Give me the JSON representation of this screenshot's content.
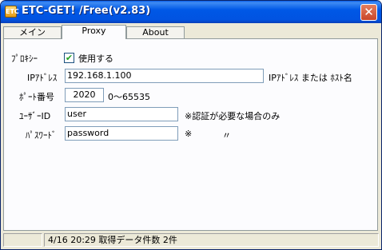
{
  "window": {
    "title": "ETC-GET! /Free(v2.83)",
    "icon_text": "ETC"
  },
  "tabs": [
    {
      "label": "メイン"
    },
    {
      "label": "Proxy"
    },
    {
      "label": "About"
    }
  ],
  "proxy": {
    "use_label": "ﾌﾟﾛｷｼｰ",
    "checkbox_label": "使用する",
    "checkbox_checked": "✔",
    "ip_label": "IPｱﾄﾞﾚｽ",
    "ip_value": "192.168.1.100",
    "ip_hint": "IPｱﾄﾞﾚｽ または ﾎｽﾄ名",
    "port_label": "ﾎﾟｰﾄ番号",
    "port_value": "2020",
    "port_hint": "0～65535",
    "user_label": "ﾕｰｻﾞｰID",
    "user_value": "user",
    "user_hint": "※認証が必要な場合のみ",
    "pass_label": "ﾊﾟｽﾜｰﾄﾞ",
    "pass_value": "password",
    "pass_hint_mark": "※",
    "pass_hint_ditto": "〃"
  },
  "status": {
    "pane1": "",
    "pane2": "4/16 20:29 取得データ件数 2件"
  }
}
